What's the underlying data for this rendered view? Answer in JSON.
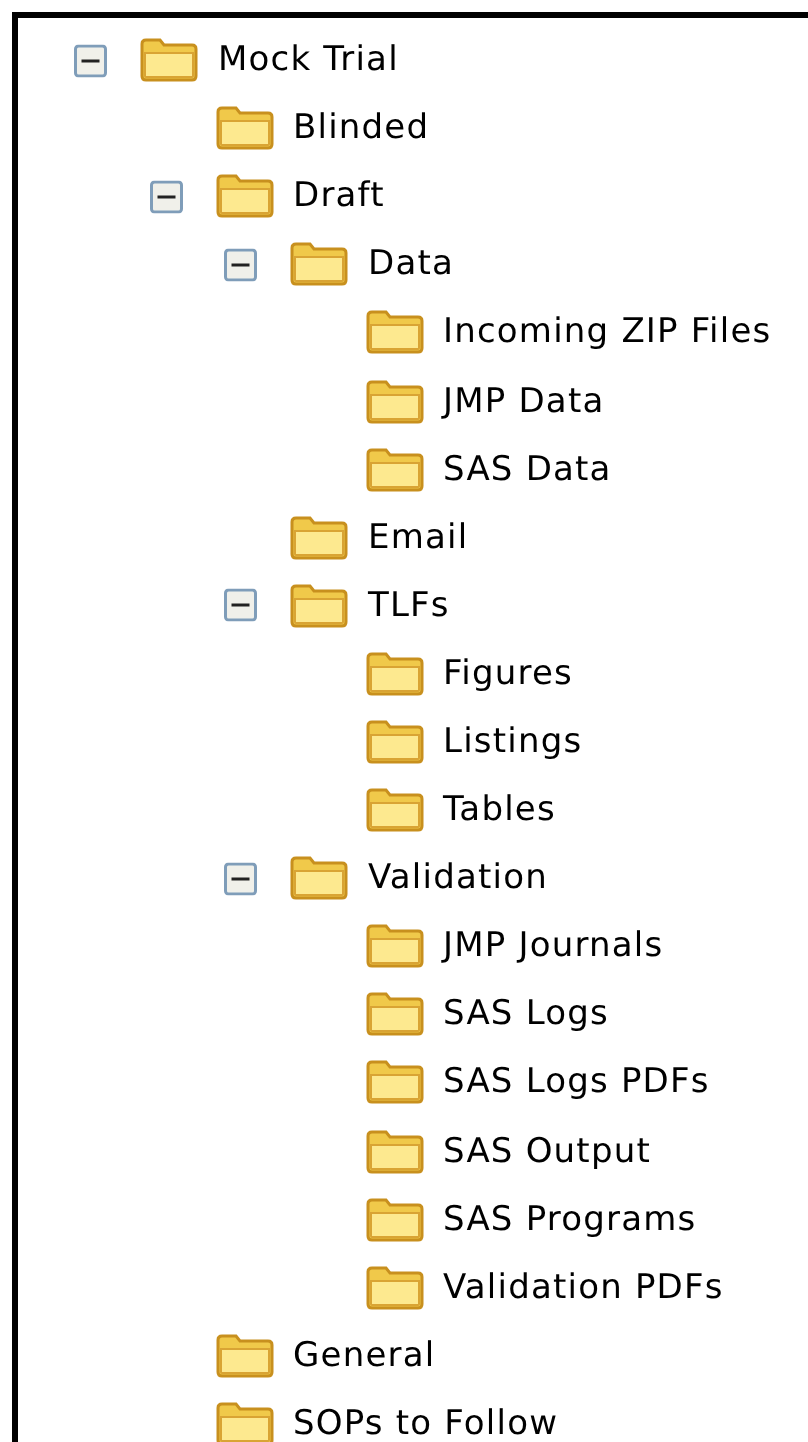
{
  "tree": [
    {
      "label": "Mock Trial",
      "expanded": true,
      "children": [
        {
          "label": "Blinded"
        },
        {
          "label": "Draft",
          "expanded": true,
          "children": [
            {
              "label": "Data",
              "expanded": true,
              "children": [
                {
                  "label": "Incoming ZIP Files"
                },
                {
                  "label": "JMP Data"
                },
                {
                  "label": "SAS Data"
                }
              ]
            },
            {
              "label": "Email"
            },
            {
              "label": "TLFs",
              "expanded": true,
              "children": [
                {
                  "label": "Figures"
                },
                {
                  "label": "Listings"
                },
                {
                  "label": "Tables"
                }
              ]
            },
            {
              "label": "Validation",
              "expanded": true,
              "children": [
                {
                  "label": "JMP Journals"
                },
                {
                  "label": "SAS Logs"
                },
                {
                  "label": "SAS Logs PDFs"
                },
                {
                  "label": "SAS Output"
                },
                {
                  "label": "SAS Programs"
                },
                {
                  "label": "Validation PDFs"
                }
              ]
            }
          ]
        },
        {
          "label": "General"
        },
        {
          "label": "SOPs to Follow"
        }
      ]
    }
  ]
}
